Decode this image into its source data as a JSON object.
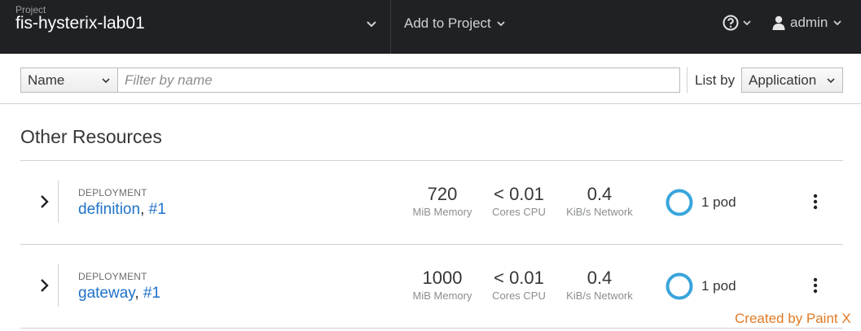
{
  "header": {
    "project_caption": "Project",
    "project_name": "fis-hysterix-lab01",
    "add_to_project": "Add to Project",
    "user_name": "admin"
  },
  "toolbar": {
    "filter_field": "Name",
    "filter_placeholder": "Filter by name",
    "list_by_label": "List by",
    "list_by_value": "Application"
  },
  "section": {
    "title": "Other Resources"
  },
  "rows": [
    {
      "kind": "DEPLOYMENT",
      "name": "definition",
      "separator": ",",
      "revision": "#1",
      "memory_value": "720",
      "memory_label": "MiB Memory",
      "cpu_value": "< 0.01",
      "cpu_label": "Cores CPU",
      "network_value": "0.4",
      "network_label": "KiB/s Network",
      "pods": "1 pod"
    },
    {
      "kind": "DEPLOYMENT",
      "name": "gateway",
      "separator": ",",
      "revision": "#1",
      "memory_value": "1000",
      "memory_label": "MiB Memory",
      "cpu_value": "< 0.01",
      "cpu_label": "Cores CPU",
      "network_value": "0.4",
      "network_label": "KiB/s Network",
      "pods": "1 pod"
    }
  ],
  "watermark": "Created by Paint X",
  "icons": {
    "project_switcher": "chevron-down-icon",
    "help": "question-circle-icon",
    "user": "user-icon",
    "expand": "chevron-right-icon",
    "actions": "kebab-icon",
    "pod_status": "donut-icon"
  },
  "colors": {
    "topbar": "#1f2125",
    "link": "#1f72c7",
    "pod_ring": "#39a5dc",
    "watermark": "#e07a25"
  }
}
